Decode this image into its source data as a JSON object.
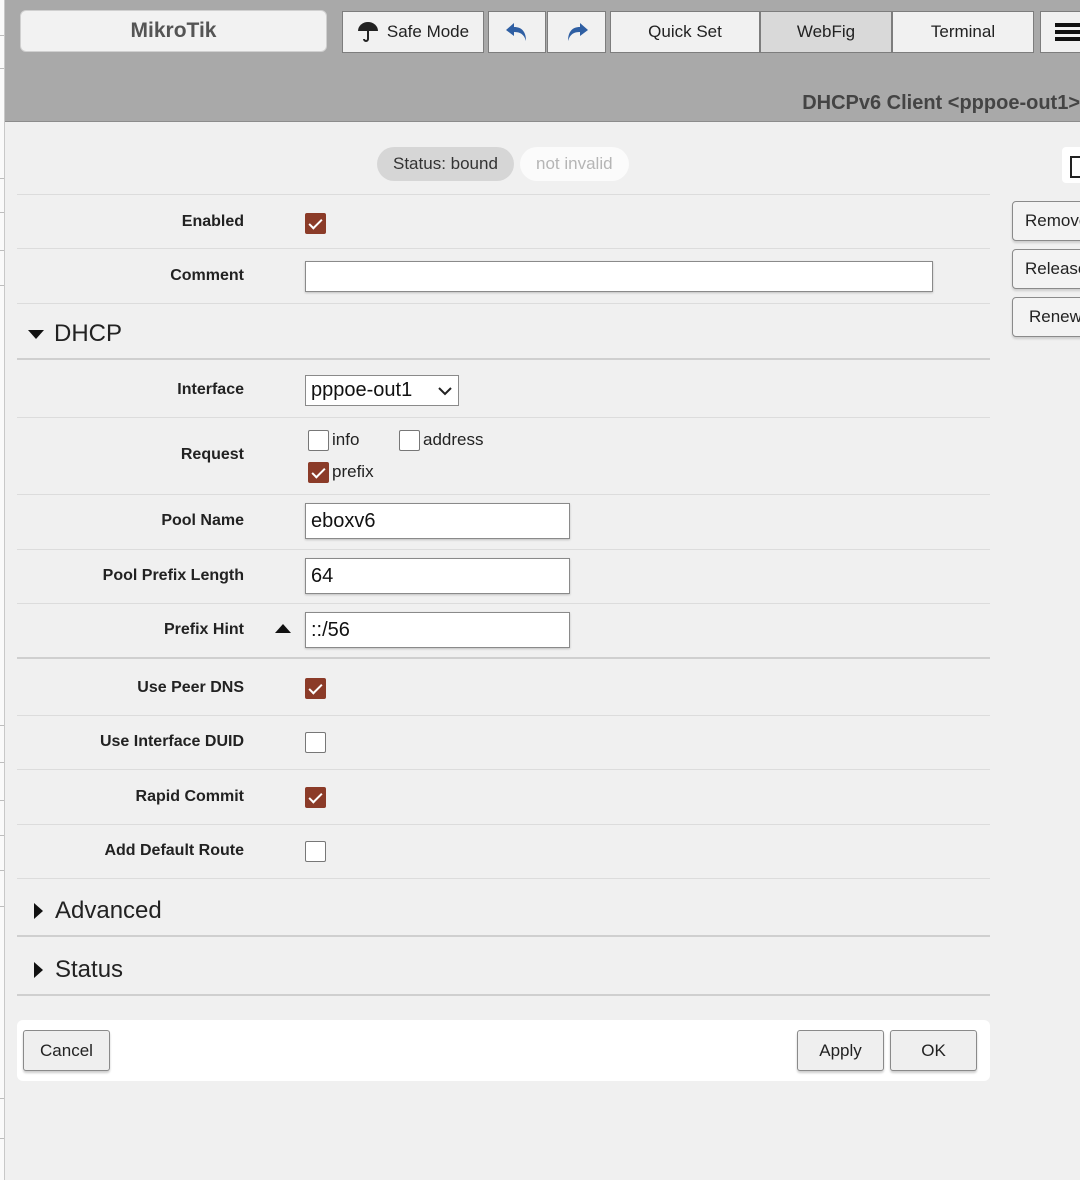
{
  "topbar": {
    "brand": "MikroTik",
    "safe_mode": "Safe Mode",
    "tabs": [
      "Quick Set",
      "WebFig",
      "Terminal"
    ],
    "active_tab": "WebFig",
    "page_title": "DHCPv6 Client <pppoe-out1>"
  },
  "status": {
    "bound": "Status: bound",
    "invalid": "not invalid"
  },
  "side_buttons": [
    "Remove",
    "Release",
    "Renew"
  ],
  "form": {
    "enabled": {
      "label": "Enabled",
      "checked": true
    },
    "comment": {
      "label": "Comment",
      "value": ""
    },
    "dhcp_section": "DHCP",
    "interface": {
      "label": "Interface",
      "value": "pppoe-out1"
    },
    "request": {
      "label": "Request",
      "options": [
        {
          "label": "info",
          "checked": false
        },
        {
          "label": "address",
          "checked": false
        },
        {
          "label": "prefix",
          "checked": true
        }
      ]
    },
    "pool_name": {
      "label": "Pool Name",
      "value": "eboxv6"
    },
    "pool_prefix_length": {
      "label": "Pool Prefix Length",
      "value": "64"
    },
    "prefix_hint": {
      "label": "Prefix Hint",
      "value": "::/56"
    },
    "use_peer_dns": {
      "label": "Use Peer DNS",
      "checked": true
    },
    "use_interface_duid": {
      "label": "Use Interface DUID",
      "checked": false
    },
    "rapid_commit": {
      "label": "Rapid Commit",
      "checked": true
    },
    "add_default_route": {
      "label": "Add Default Route",
      "checked": false
    },
    "advanced_section": "Advanced",
    "status_section": "Status"
  },
  "footer": {
    "cancel": "Cancel",
    "apply": "Apply",
    "ok": "OK"
  },
  "colors": {
    "checkbox_checked": "#8b3b28",
    "topbar_bg": "#a9a9a9",
    "page_bg": "#f0f0f0"
  }
}
